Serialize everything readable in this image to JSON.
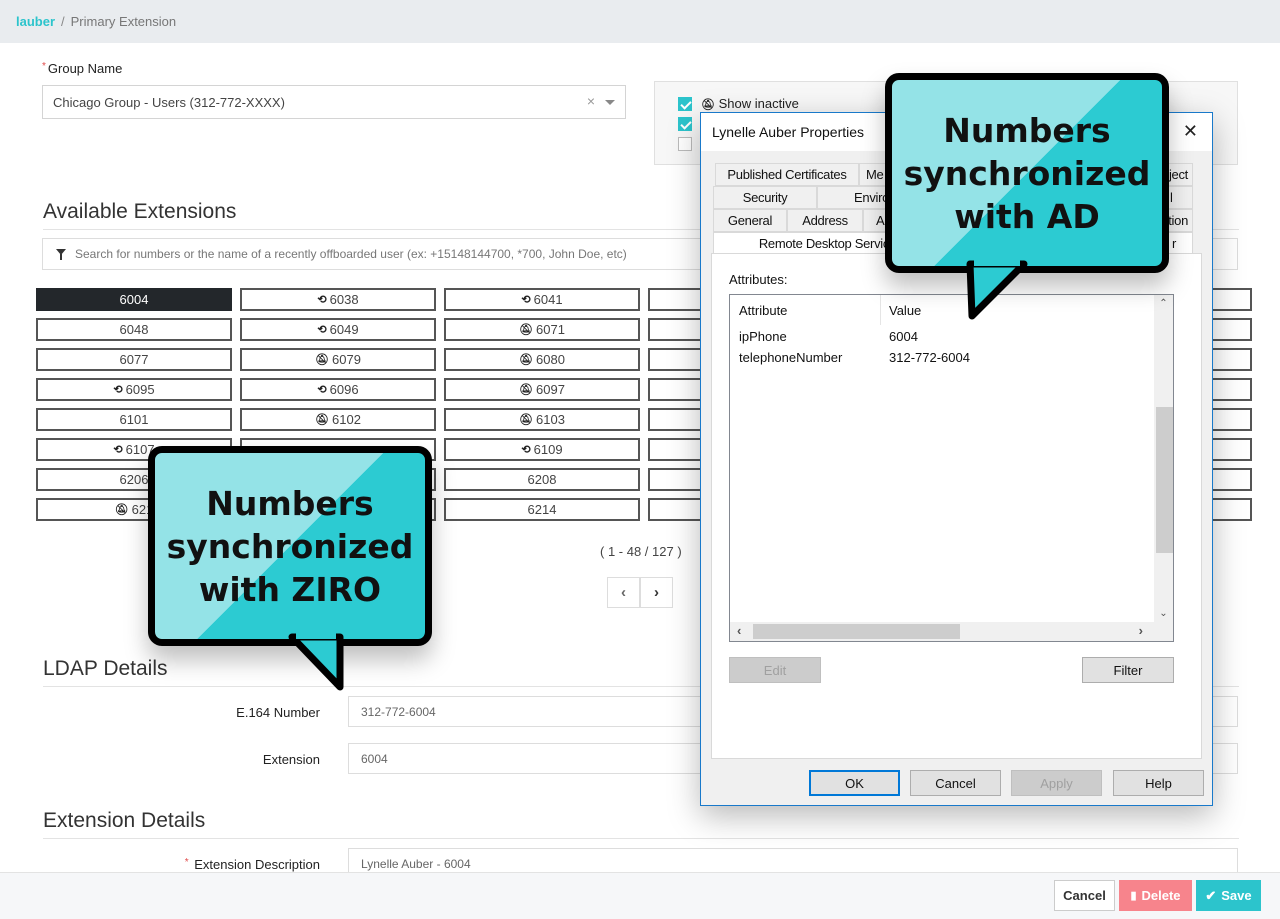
{
  "breadcrumb": {
    "parent": "lauber",
    "separator": "/",
    "current": "Primary Extension"
  },
  "group": {
    "label": "Group Name",
    "required": true,
    "value": "Chicago Group - Users (312-772-XXXX)"
  },
  "options": [
    {
      "label": "Show inactive",
      "checked": true,
      "icon": "bell-slash-icon"
    },
    {
      "label": "",
      "checked": true
    },
    {
      "label": "",
      "checked": false
    }
  ],
  "available_extensions": {
    "title": "Available Extensions",
    "search_placeholder": "Search for numbers or the name of a recently offboarded user (ex: +15148144700, *700, John Doe, etc)",
    "grid": [
      [
        {
          "n": "6004",
          "icon": "",
          "selected": true
        },
        {
          "n": "6038",
          "icon": "history"
        },
        {
          "n": "6041",
          "icon": "history"
        },
        {
          "n": "",
          "icon": ""
        },
        {
          "n": "",
          "icon": ""
        },
        {
          "n": "",
          "icon": ""
        }
      ],
      [
        {
          "n": "6048",
          "icon": ""
        },
        {
          "n": "6049",
          "icon": "history"
        },
        {
          "n": "6071",
          "icon": "bell-slash"
        },
        {
          "n": "",
          "icon": ""
        },
        {
          "n": "",
          "icon": ""
        },
        {
          "n": "",
          "icon": ""
        }
      ],
      [
        {
          "n": "6077",
          "icon": ""
        },
        {
          "n": "6079",
          "icon": "bell-slash"
        },
        {
          "n": "6080",
          "icon": "bell-slash"
        },
        {
          "n": "",
          "icon": ""
        },
        {
          "n": "",
          "icon": ""
        },
        {
          "n": "",
          "icon": ""
        }
      ],
      [
        {
          "n": "6095",
          "icon": "history"
        },
        {
          "n": "6096",
          "icon": "history"
        },
        {
          "n": "6097",
          "icon": "bell-slash"
        },
        {
          "n": "",
          "icon": ""
        },
        {
          "n": "",
          "icon": ""
        },
        {
          "n": "",
          "icon": ""
        }
      ],
      [
        {
          "n": "6101",
          "icon": ""
        },
        {
          "n": "6102",
          "icon": "bell-slash"
        },
        {
          "n": "6103",
          "icon": "bell-slash"
        },
        {
          "n": "",
          "icon": ""
        },
        {
          "n": "",
          "icon": ""
        },
        {
          "n": "",
          "icon": ""
        }
      ],
      [
        {
          "n": "6107",
          "icon": "history"
        },
        {
          "n": "",
          "icon": ""
        },
        {
          "n": "6109",
          "icon": "history"
        },
        {
          "n": "",
          "icon": ""
        },
        {
          "n": "",
          "icon": ""
        },
        {
          "n": "",
          "icon": ""
        }
      ],
      [
        {
          "n": "6206",
          "icon": ""
        },
        {
          "n": "",
          "icon": ""
        },
        {
          "n": "6208",
          "icon": ""
        },
        {
          "n": "",
          "icon": ""
        },
        {
          "n": "",
          "icon": ""
        },
        {
          "n": "",
          "icon": ""
        }
      ],
      [
        {
          "n": "621",
          "icon": "bell-slash"
        },
        {
          "n": "",
          "icon": ""
        },
        {
          "n": "6214",
          "icon": ""
        },
        {
          "n": "",
          "icon": ""
        },
        {
          "n": "",
          "icon": ""
        },
        {
          "n": "",
          "icon": ""
        }
      ]
    ],
    "paging": "( 1 - 48 / 127 )",
    "prev_label": "‹",
    "next_label": "›"
  },
  "ldap": {
    "title": "LDAP Details",
    "e164_label": "E.164 Number",
    "e164_value": "312-772-6004",
    "extension_label": "Extension",
    "extension_value": "6004"
  },
  "extension_details": {
    "title": "Extension Details",
    "description_label": "Extension Description",
    "description_value": "Lynelle Auber - 6004"
  },
  "footer": {
    "cancel": "Cancel",
    "delete": "Delete",
    "save": "Save"
  },
  "dialog": {
    "title": "Lynelle Auber Properties",
    "tabs_row1": [
      "Published Certificates",
      "Me",
      "ject"
    ],
    "tabs_row2": [
      "Security",
      "Environ",
      "l"
    ],
    "tabs_row3": [
      "General",
      "Address",
      "A",
      "tion"
    ],
    "tabs_row4": [
      "Remote Desktop Service",
      "r"
    ],
    "attributes_label": "Attributes:",
    "columns": [
      "Attribute",
      "Value"
    ],
    "rows": [
      {
        "attribute": "ipPhone",
        "value": "6004"
      },
      {
        "attribute": "telephoneNumber",
        "value": "312-772-6004"
      }
    ],
    "edit": "Edit",
    "filter": "Filter",
    "ok": "OK",
    "cancel": "Cancel",
    "apply": "Apply",
    "help": "Help"
  },
  "callouts": {
    "ad": "Numbers\nsynchronized\nwith AD",
    "ziro": "Numbers\nsynchronized\nwith ZIRO"
  },
  "colors": {
    "accent": "#2cc4cc",
    "danger": "#f7848c",
    "selected": "#23272b",
    "callout_light": "#94e3e7",
    "callout_dark": "#2ccbd2"
  }
}
